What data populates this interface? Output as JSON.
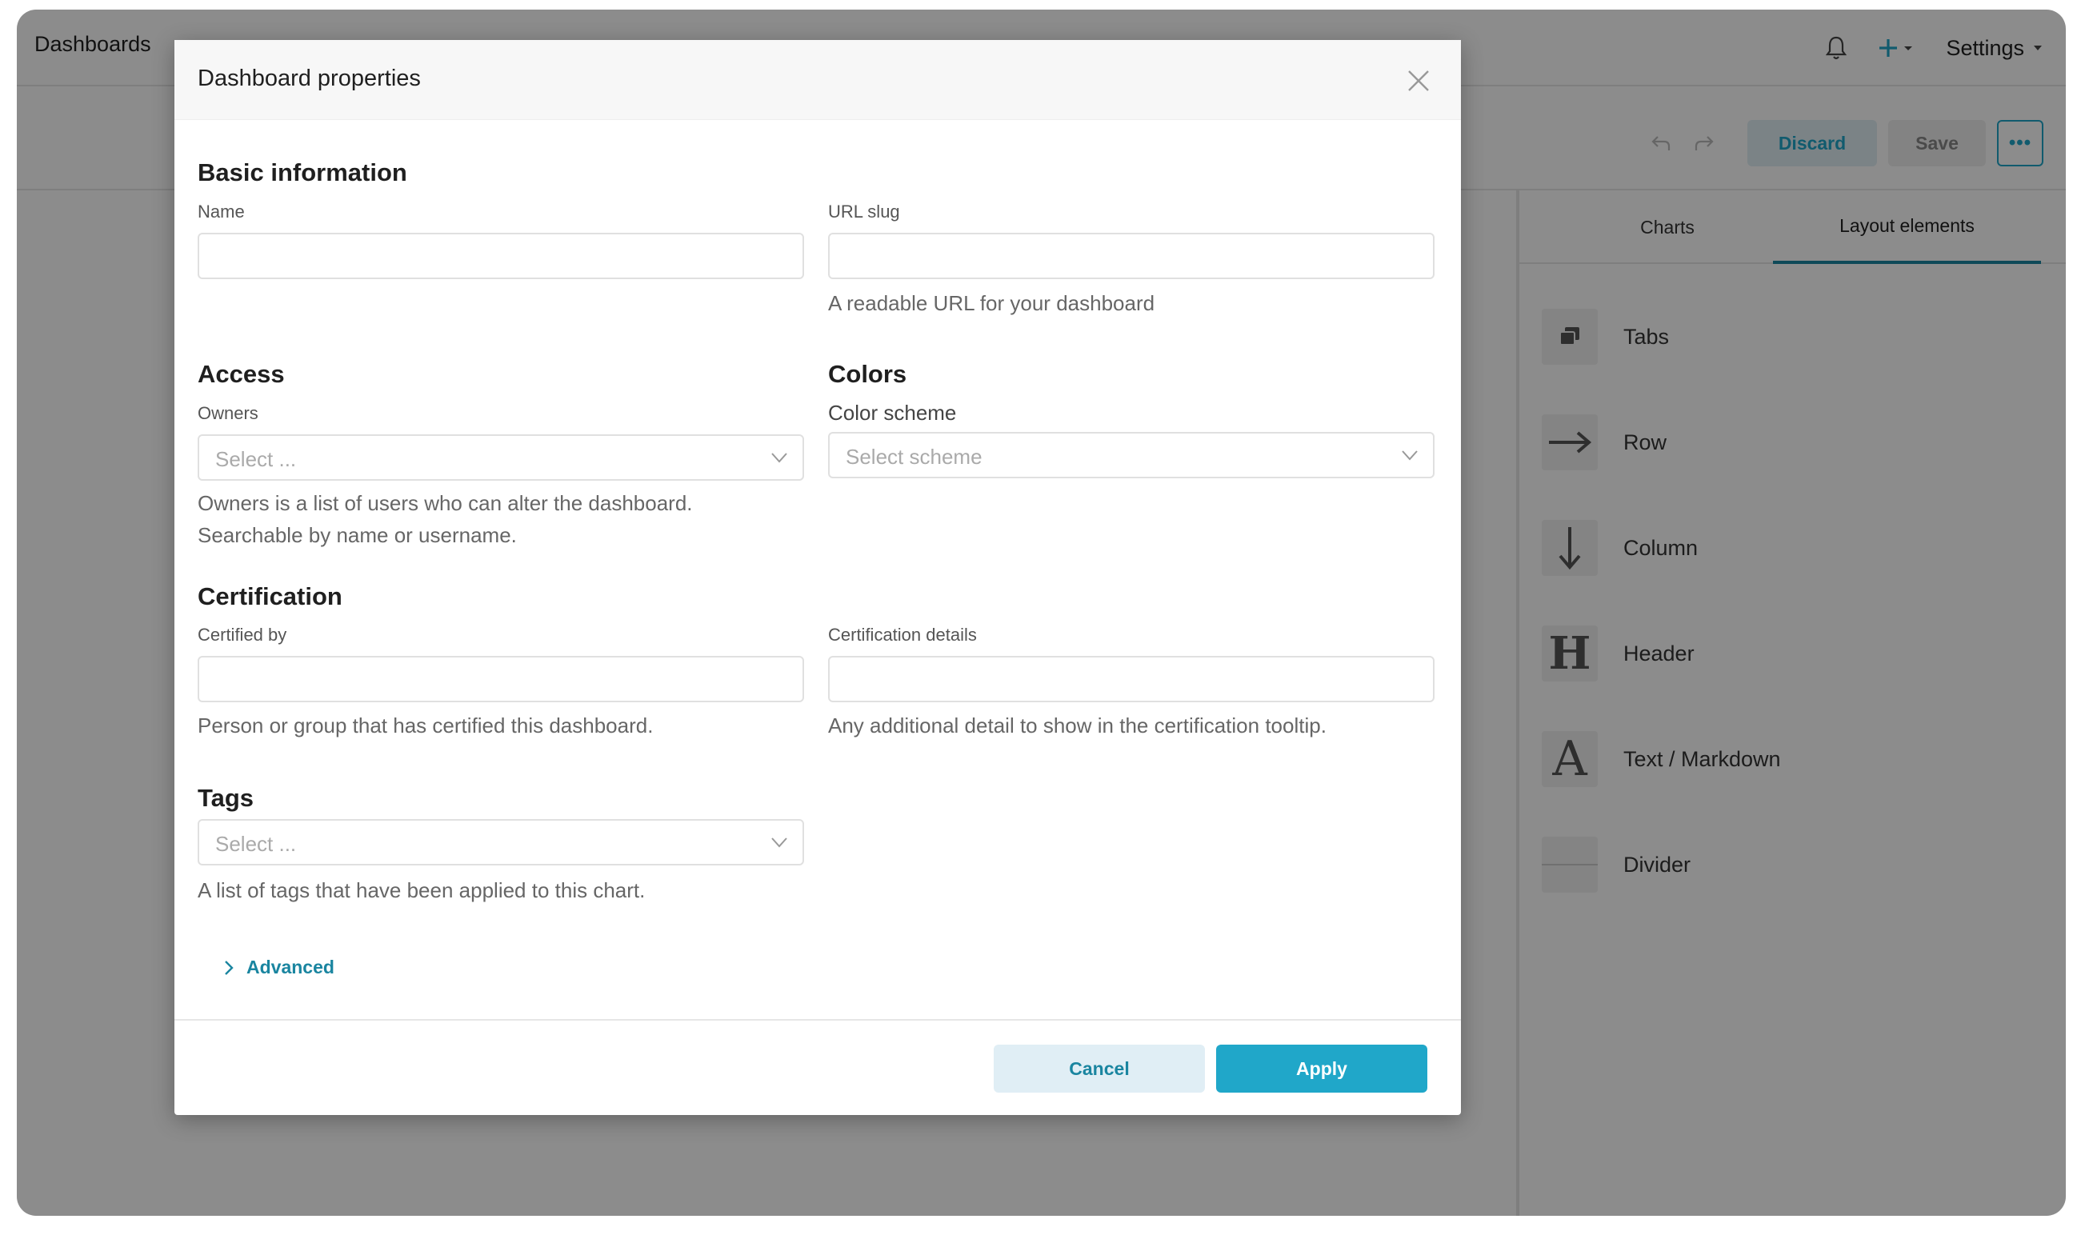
{
  "topnav": {
    "brand": "Dashboards",
    "settings_label": "Settings"
  },
  "toolbar": {
    "discard_label": "Discard",
    "save_label": "Save"
  },
  "sidepanel": {
    "tabs": [
      {
        "label": "Charts",
        "active": false
      },
      {
        "label": "Layout elements",
        "active": true
      }
    ],
    "items": [
      {
        "label": "Tabs",
        "icon": "tabs-icon"
      },
      {
        "label": "Row",
        "icon": "arrow-right-icon"
      },
      {
        "label": "Column",
        "icon": "arrow-down-icon"
      },
      {
        "label": "Header",
        "icon": "header-icon"
      },
      {
        "label": "Text / Markdown",
        "icon": "text-icon"
      },
      {
        "label": "Divider",
        "icon": "divider-icon"
      }
    ]
  },
  "modal": {
    "title": "Dashboard properties",
    "basic": {
      "title": "Basic information",
      "name_label": "Name",
      "name_value": "",
      "slug_label": "URL slug",
      "slug_value": "",
      "slug_help": "A readable URL for your dashboard"
    },
    "access": {
      "title": "Access",
      "owners_label": "Owners",
      "owners_placeholder": "Select ...",
      "owners_help_1": "Owners is a list of users who can alter the dashboard.",
      "owners_help_2": "Searchable by name or username."
    },
    "colors": {
      "title": "Colors",
      "scheme_label": "Color scheme",
      "scheme_placeholder": "Select scheme"
    },
    "certification": {
      "title": "Certification",
      "certified_by_label": "Certified by",
      "certified_by_value": "",
      "certified_by_help": "Person or group that has certified this dashboard.",
      "details_label": "Certification details",
      "details_value": "",
      "details_help": "Any additional detail to show in the certification tooltip."
    },
    "tags": {
      "title": "Tags",
      "placeholder": "Select ...",
      "help": "A list of tags that have been applied to this chart."
    },
    "advanced_label": "Advanced",
    "cancel_label": "Cancel",
    "apply_label": "Apply"
  },
  "colors": {
    "accent": "#20a7c9",
    "accent_dark": "#1a85a0",
    "overlay": "rgba(0,0,0,0.45)"
  }
}
